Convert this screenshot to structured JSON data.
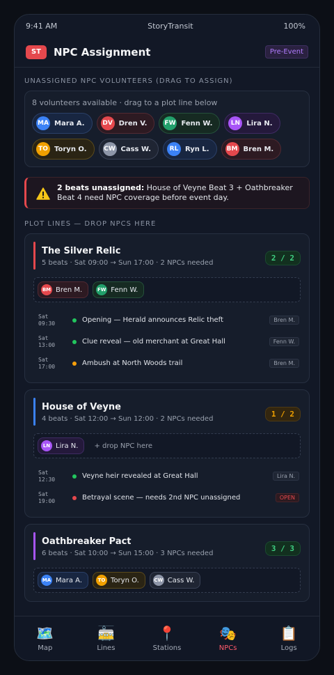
{
  "status": {
    "time": "9:41 AM",
    "carrier": "StoryTransit",
    "battery": "100%"
  },
  "header": {
    "logo": "ST",
    "title": "NPC Assignment",
    "badge": "Pre-Event"
  },
  "volunteers": {
    "section_title": "UNASSIGNED NPC VOLUNTEERS (DRAG TO ASSIGN)",
    "hint": "8 volunteers available · drag to a plot line below",
    "items": [
      {
        "initials": "MA",
        "name": "Mara A.",
        "color": "blue"
      },
      {
        "initials": "DV",
        "name": "Dren V.",
        "color": "red"
      },
      {
        "initials": "FW",
        "name": "Fenn W.",
        "color": "green"
      },
      {
        "initials": "LN",
        "name": "Lira N.",
        "color": "purple"
      },
      {
        "initials": "TO",
        "name": "Toryn O.",
        "color": "amber"
      },
      {
        "initials": "CW",
        "name": "Cass W.",
        "color": "gray"
      },
      {
        "initials": "RL",
        "name": "Ryn L.",
        "color": "blue"
      },
      {
        "initials": "BM",
        "name": "Bren M.",
        "color": "red"
      }
    ]
  },
  "alert": {
    "icon": "warning-icon",
    "strong": "2 beats unassigned:",
    "text": " House of Veyne Beat 3 + Oathbreaker Beat 4 need NPC coverage before event day."
  },
  "plots": {
    "section_title": "PLOT LINES — DROP NPCS HERE",
    "items": [
      {
        "title": "The Silver Relic",
        "meta": "5 beats · Sat 09:00 → Sun 17:00 · 2 NPCs needed",
        "count": "2 / 2",
        "status": "ok",
        "color": "#e5484d",
        "assigned": [
          {
            "initials": "BM",
            "name": "Bren M.",
            "color": "red"
          },
          {
            "initials": "FW",
            "name": "Fenn W.",
            "color": "green"
          }
        ],
        "drop_hint": "",
        "beats": [
          {
            "day": "Sat",
            "time": "09:30",
            "text": "Opening — Herald announces Relic theft",
            "tag": "Bren M.",
            "dot": "#22c55e",
            "open": false
          },
          {
            "day": "Sat",
            "time": "13:00",
            "text": "Clue reveal — old merchant at Great Hall",
            "tag": "Fenn W.",
            "dot": "#22c55e",
            "open": false
          },
          {
            "day": "Sat",
            "time": "17:00",
            "text": "Ambush at North Woods trail",
            "tag": "Bren M.",
            "dot": "#f59e0b",
            "open": false
          }
        ]
      },
      {
        "title": "House of Veyne",
        "meta": "4 beats · Sat 12:00 → Sun 12:00 · 2 NPCs needed",
        "count": "1 / 2",
        "status": "warn",
        "color": "#3b82f6",
        "assigned": [
          {
            "initials": "LN",
            "name": "Lira N.",
            "color": "purple"
          }
        ],
        "drop_hint": "+ drop NPC here",
        "beats": [
          {
            "day": "Sat",
            "time": "12:30",
            "text": "Veyne heir revealed at Great Hall",
            "tag": "Lira N.",
            "dot": "#22c55e",
            "open": false
          },
          {
            "day": "Sat",
            "time": "19:00",
            "text": "Betrayal scene — needs 2nd NPC unassigned",
            "tag": "OPEN",
            "dot": "#e5484d",
            "open": true
          }
        ]
      },
      {
        "title": "Oathbreaker Pact",
        "meta": "6 beats · Sat 10:00 → Sun 15:00 · 3 NPCs needed",
        "count": "3 / 3",
        "status": "ok",
        "color": "#a855f7",
        "assigned": [
          {
            "initials": "MA",
            "name": "Mara A.",
            "color": "blue"
          },
          {
            "initials": "TO",
            "name": "Toryn O.",
            "color": "amber"
          },
          {
            "initials": "CW",
            "name": "Cass W.",
            "color": "gray"
          }
        ],
        "drop_hint": "",
        "beats": []
      }
    ]
  },
  "nav": [
    {
      "label": "Map",
      "icon": "map-icon",
      "glyph": "🗺️",
      "active": false
    },
    {
      "label": "Lines",
      "icon": "train-icon",
      "glyph": "🚋",
      "active": false
    },
    {
      "label": "Stations",
      "icon": "pin-icon",
      "glyph": "📍",
      "active": false
    },
    {
      "label": "NPCs",
      "icon": "masks-icon",
      "glyph": "🎭",
      "active": true
    },
    {
      "label": "Logs",
      "icon": "clipboard-icon",
      "glyph": "📋",
      "active": false
    }
  ]
}
